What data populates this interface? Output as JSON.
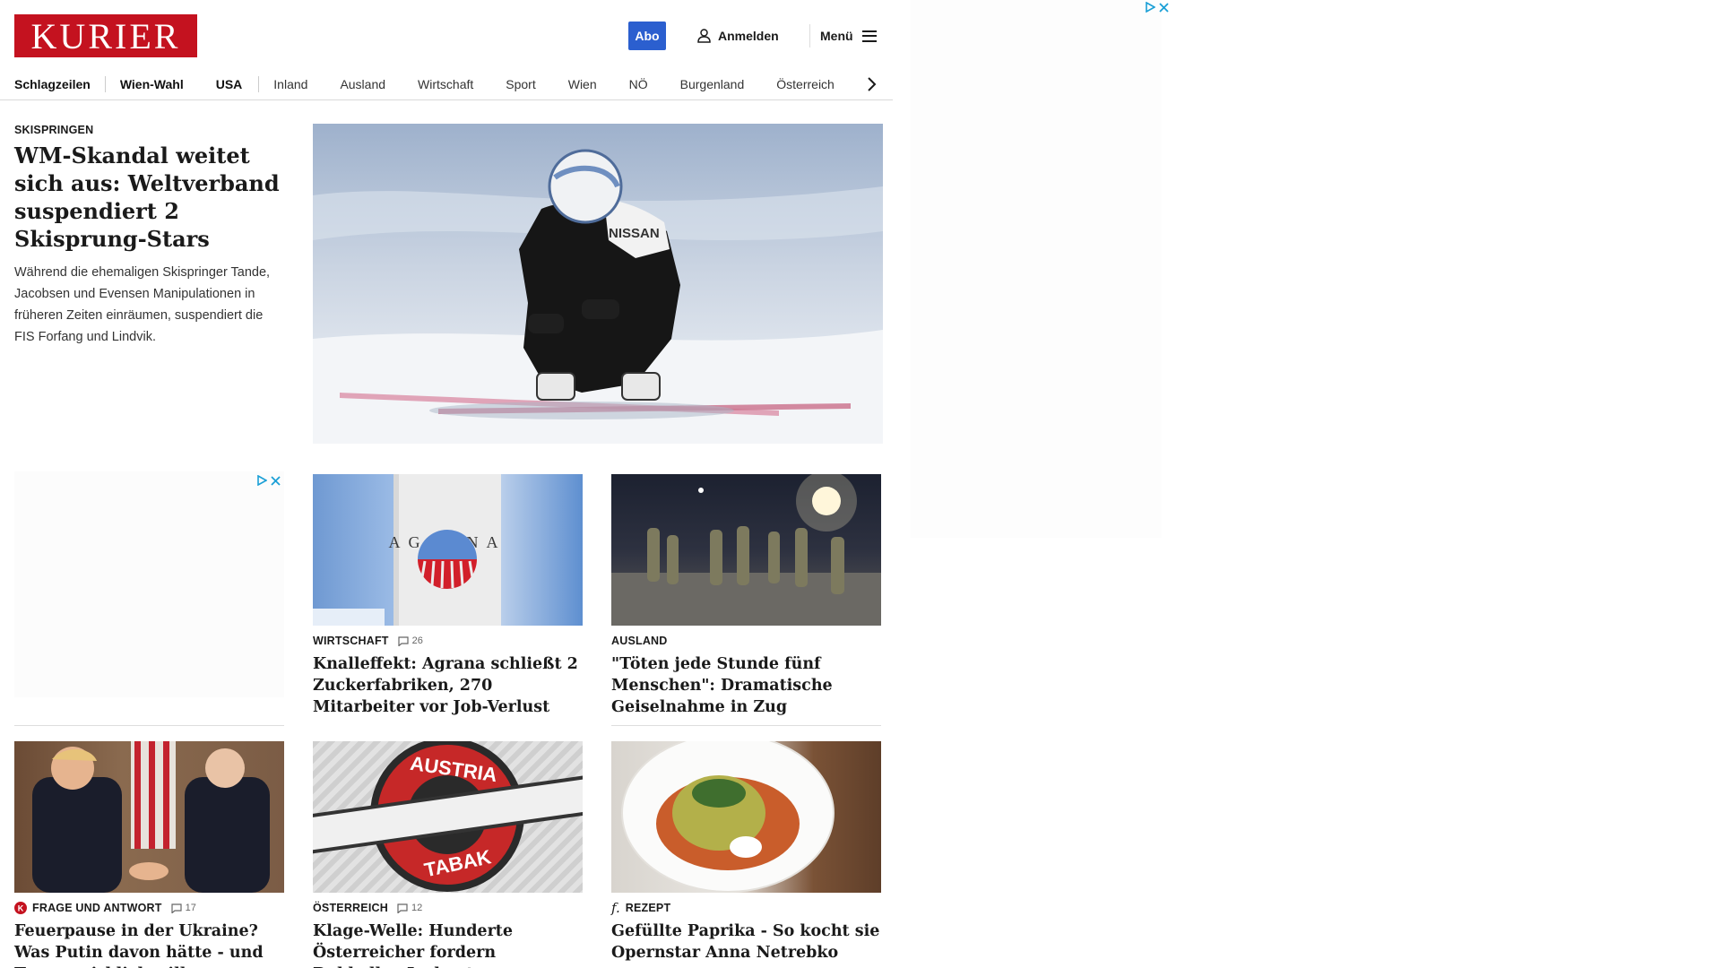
{
  "header": {
    "logo": "KURIER",
    "abo_label": "Abo",
    "login_label": "Anmelden",
    "menu_label": "Menü"
  },
  "nav": {
    "items": [
      "Schlagzeilen",
      "Wien-Wahl",
      "USA",
      "Inland",
      "Ausland",
      "Wirtschaft",
      "Sport",
      "Wien",
      "NÖ",
      "Burgenland",
      "Österreich"
    ]
  },
  "lead": {
    "kicker": "SKISPRINGEN",
    "title": "WM-Skandal weitet sich aus: Weltverband suspendiert 2 Skisprung-Stars",
    "teaser": "Während die ehemaligen Skispringer Tande, Jacobsen und Evensen Manipulationen in früheren Zeiten einräumen, suspendiert die FIS Forfang und Lindvik.",
    "image_text": "NISSAN"
  },
  "cards": [
    {
      "kicker": "WIRTSCHAFT",
      "comments": "26",
      "title": "Knalleffekt: Agrana schließt 2 Zuckerfabriken, 270 Mitarbeiter vor Job-Verlust",
      "image_text": "AGRANA"
    },
    {
      "kicker": "AUSLAND",
      "comments": "",
      "title": "\"Töten jede Stunde fünf Menschen\": Dramatische Geiselnahme in Zug"
    },
    {
      "kicker": "FRAGE UND ANTWORT",
      "comments": "17",
      "title": "Feuerpause in der Ukraine? Was Putin davon hätte - und Trump wirklich will"
    },
    {
      "kicker": "ÖSTERREICH",
      "comments": "12",
      "title": "Klage-Welle: Hunderte Österreicher fordern Rubbellos-Jackpot",
      "image_text_top": "AUSTRIA",
      "image_text_bottom": "TABAK"
    },
    {
      "kicker": "REZEPT",
      "comments": "",
      "title": "Gefüllte Paprika - So kocht sie Opernstar Anna Netrebko"
    }
  ],
  "colors": {
    "brand_red": "#c4121f",
    "abo_blue": "#2b5fcf",
    "ad_icon": "#1a9fd6"
  }
}
